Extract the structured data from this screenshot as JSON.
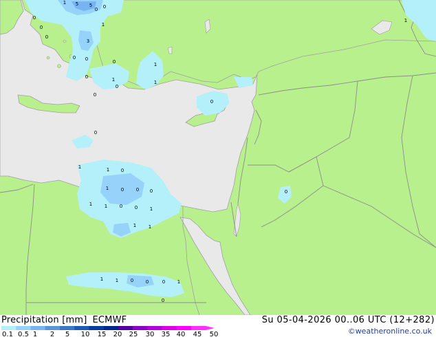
{
  "title": {
    "product": "Precipitation [mm]",
    "model": "ECMWF",
    "valid": "Su 05-04-2026 00..06 UTC (12+282)",
    "credit": "©weatheronline.co.uk"
  },
  "colors": {
    "land": "#b9f08e",
    "sea": "#e9e9e9",
    "border": "#8c8c8c",
    "coast": "#a0a0a0"
  },
  "legend": {
    "labels": [
      "0.1",
      "0.5",
      "1",
      "2",
      "5",
      "10",
      "15",
      "20",
      "25",
      "30",
      "35",
      "40",
      "45",
      "50"
    ],
    "colors": [
      "#b4f0fa",
      "#96d2fa",
      "#78b4f0",
      "#5a96dc",
      "#3c78c8",
      "#1e5ab4",
      "#0a3ca0",
      "#00288c",
      "#5000a0",
      "#8c00c8",
      "#b400dc",
      "#dc00e6",
      "#ff00ff",
      "#ff30ff"
    ]
  },
  "point_labels": [
    "1",
    "5",
    "5",
    "0",
    "0",
    "1",
    "0",
    "3",
    "0",
    "0",
    "0",
    "0",
    "1",
    "0",
    "1",
    "1",
    "0",
    "1",
    "0",
    "1",
    "1",
    "0",
    "1",
    "0",
    "0",
    "0",
    "1",
    "1",
    "0",
    "0",
    "1",
    "1",
    "1",
    "1",
    "1",
    "0",
    "0",
    "0",
    "1",
    "0",
    "0",
    "0",
    "0",
    "0"
  ]
}
